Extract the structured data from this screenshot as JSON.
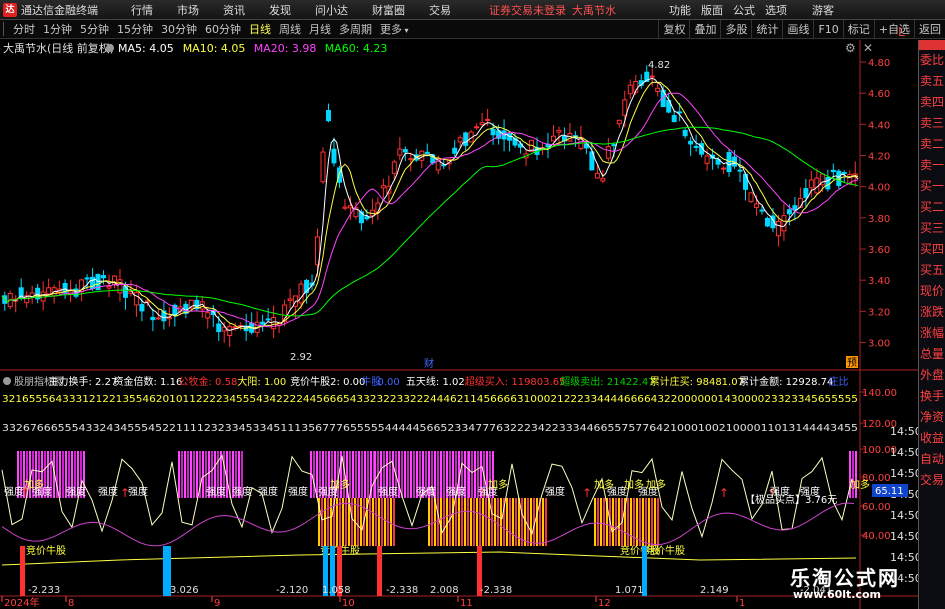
{
  "window": {
    "title": "通达信金融终端",
    "menus": [
      "行情",
      "市场",
      "资讯",
      "发现",
      "问小达",
      "财富圈",
      "交易"
    ],
    "login_status": "证券交易未登录",
    "stock_name": "大禹节水",
    "right_menus": [
      "功能",
      "版面",
      "公式",
      "选项"
    ],
    "guest": "游客"
  },
  "toolbar": {
    "periods": [
      "分时",
      "1分钟",
      "5分钟",
      "15分钟",
      "30分钟",
      "60分钟",
      "日线",
      "周线",
      "月线",
      "多周期",
      "更多"
    ],
    "active_period": "日线",
    "right_buttons": [
      "复权",
      "叠加",
      "多股",
      "统计",
      "画线",
      "F10",
      "标记",
      "+自选",
      "返回"
    ]
  },
  "sidebar": {
    "items": [
      "委比",
      "卖五",
      "卖四",
      "卖三",
      "卖二",
      "卖一",
      "买一",
      "买二",
      "买三",
      "买四",
      "买五",
      "现价",
      "涨跌",
      "涨幅",
      "总量",
      "外盘",
      "换手",
      "净资",
      "收益",
      "自动",
      "交易"
    ]
  },
  "main_panel": {
    "stock_label": "大禹节水(日线 前复权)",
    "ma": [
      {
        "label": "MA5: 4.05",
        "color": "#ffffff"
      },
      {
        "label": "MA10: 4.05",
        "color": "#ffff44"
      },
      {
        "label": "MA20: 3.98",
        "color": "#ff44ff"
      },
      {
        "label": "MA60: 4.23",
        "color": "#00ff00"
      }
    ],
    "high_label": "4.82",
    "low_label": "2.92",
    "marker_cai": "财",
    "marker_yu": "预"
  },
  "indicator_panel": {
    "items": [
      {
        "text": "股朋指标网",
        "color": "#c0c0c0"
      },
      {
        "text": "主力换手: 2.27",
        "color": "#ffffff"
      },
      {
        "text": "资金倍数: 1.16",
        "color": "#ffffff"
      },
      {
        "text": "公牧金: 0.58",
        "color": "#ff3030"
      },
      {
        "text": "大阳: 1.00",
        "color": "#ffff40"
      },
      {
        "text": "竞价牛股2: 0.00",
        "color": "#ffffff"
      },
      {
        "text": "牛股",
        "color": "#4060ff"
      },
      {
        "text": "0.00",
        "color": "#4060ff"
      },
      {
        "text": "五天线: 1.02",
        "color": "#ffffff"
      },
      {
        "text": "超级买入: 119803.65",
        "color": "#ff3030"
      },
      {
        "text": "超级卖出: 21422.47",
        "color": "#00d000"
      },
      {
        "text": "累计庄买: 98481.07",
        "color": "#ffff40"
      },
      {
        "text": "累计金额: 12928.74",
        "color": "#ffffff"
      },
      {
        "text": "庄比",
        "color": "#4060ff"
      }
    ],
    "digits_row1": "32165556433312122135546201011222234555434222244566654332322332224446211456666310002122233444466664322000000143000023323345655555",
    "digits_row2": "332676665554332434555452211112323345334511135677765555544444566523347776322234223334466557577642100010021000011013144443455",
    "tags": {
      "qiangdu": "强度",
      "jiaduo": "加多",
      "jingjia": "竞价牛股",
      "jidian": "【极品买点】3.76元",
      "value_badge": "65.11"
    },
    "bottom_numbers": [
      "-2.233",
      "3.026",
      "-2.120",
      "1.058",
      "-2.338",
      "2.008",
      "-2.338",
      "1.071",
      "2.149",
      "-2.041"
    ]
  },
  "watermark": {
    "line1": "乐淘公式网",
    "line2": "www.60lt.com"
  },
  "chart_data": {
    "type": "candlestick",
    "title": "大禹节水(日线 前复权)",
    "price_axis": {
      "ticks": [
        4.8,
        4.6,
        4.4,
        4.2,
        4.0,
        3.8,
        3.6,
        3.4,
        3.2,
        3.0
      ],
      "range": [
        2.92,
        4.82
      ]
    },
    "indicator_axis": {
      "ticks": [
        140.0,
        120.0,
        100.0,
        80.0,
        60.0,
        40.0
      ]
    },
    "x_labels": [
      "2024年",
      "8",
      "9",
      "10",
      "11",
      "12",
      "1"
    ],
    "high": 4.82,
    "low": 2.92,
    "last": {
      "MA5": 4.05,
      "MA10": 4.05,
      "MA20": 3.98,
      "MA60": 4.23
    },
    "seed": 20240731
  }
}
